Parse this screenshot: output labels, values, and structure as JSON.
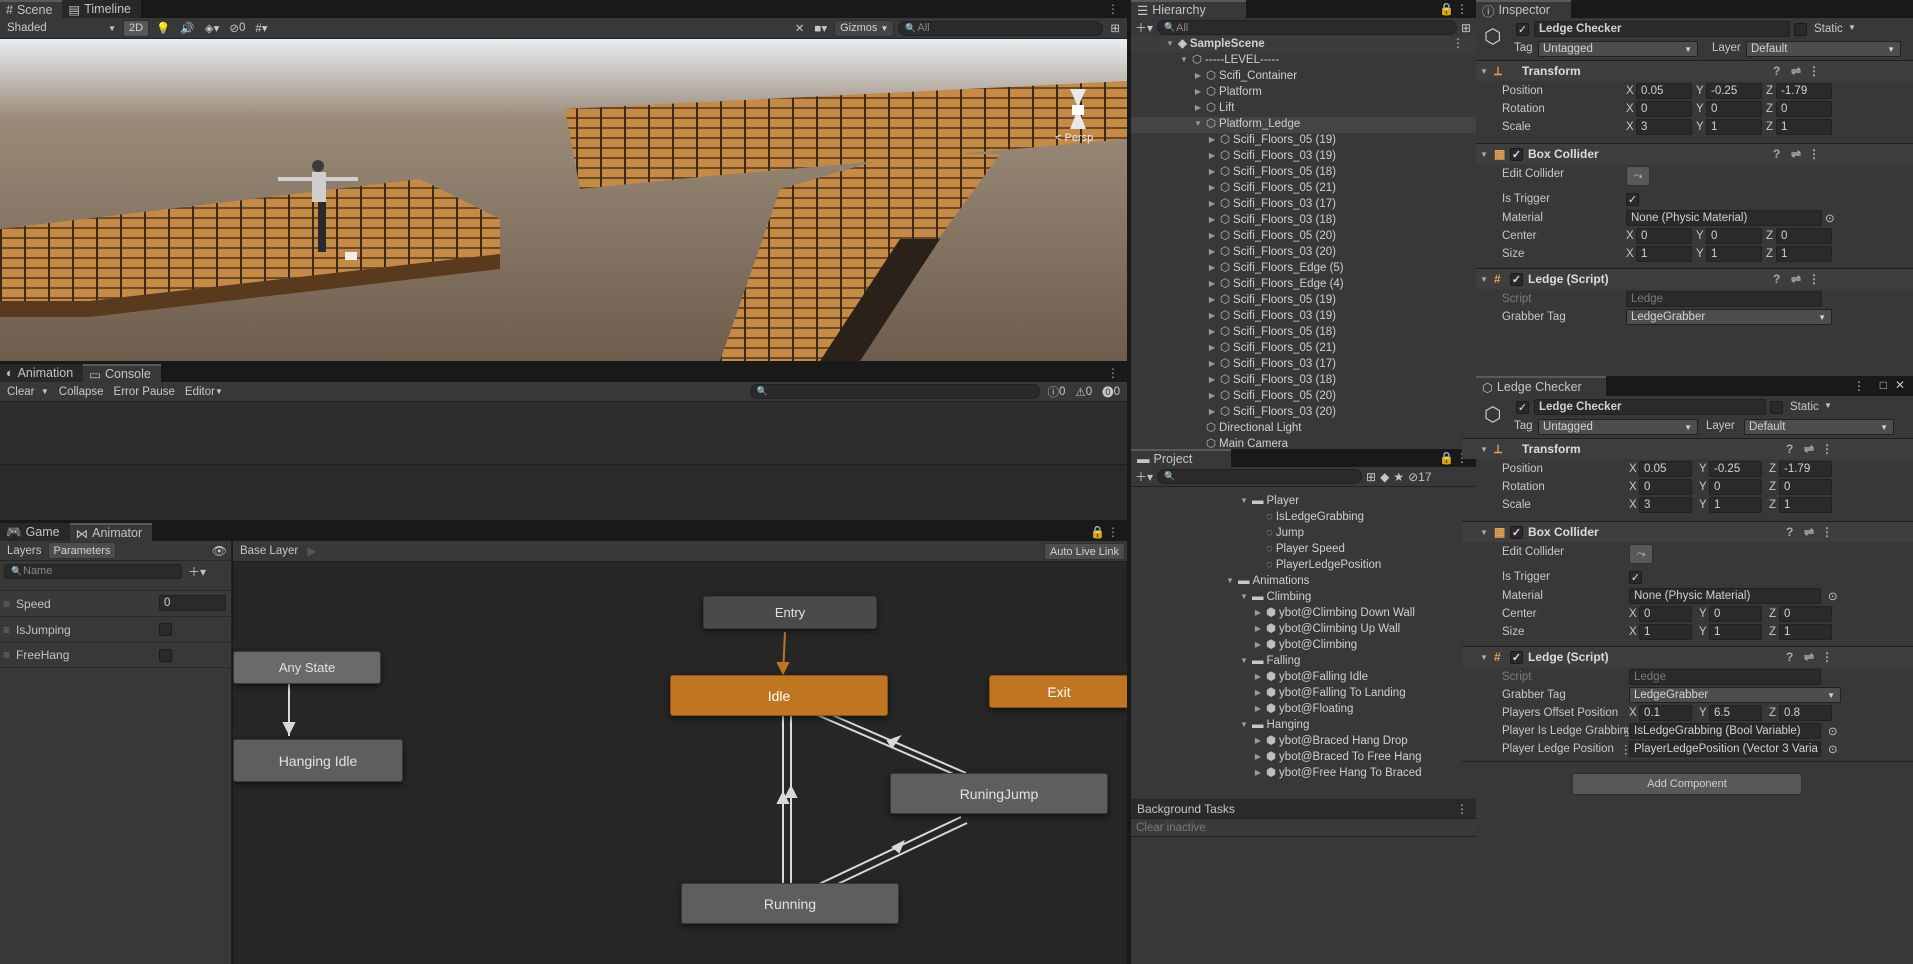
{
  "scene_tabs": [
    {
      "label": "Scene",
      "icon": "hash-icon"
    },
    {
      "label": "Timeline",
      "icon": "timeline-icon"
    }
  ],
  "scene_toolbar": {
    "shading": "Shaded",
    "mode_2d": "2D",
    "hidden_count": "0",
    "gizmos": "Gizmos",
    "search_placeholder": "All",
    "persp": "< Persp"
  },
  "console_tabs": [
    {
      "label": "Animation"
    },
    {
      "label": "Console"
    }
  ],
  "console_toolbar": {
    "clear": "Clear",
    "collapse": "Collapse",
    "error_pause": "Error Pause",
    "editor": "Editor",
    "log_count": "0",
    "warn_count": "0",
    "error_count": "0"
  },
  "game_tabs": [
    {
      "label": "Game"
    },
    {
      "label": "Animator"
    }
  ],
  "animator": {
    "layers_tab": "Layers",
    "parameters_tab": "Parameters",
    "name_placeholder": "Name",
    "base_layer": "Base Layer",
    "auto_live_link": "Auto Live Link",
    "parameters": [
      {
        "name": "Speed",
        "type": "float",
        "value": "0"
      },
      {
        "name": "IsJumping",
        "type": "bool",
        "value": false
      },
      {
        "name": "FreeHang",
        "type": "bool",
        "value": false
      }
    ],
    "states": {
      "entry": "Entry",
      "any_state": "Any State",
      "idle": "Idle",
      "exit": "Exit",
      "hanging_idle": "Hanging Idle",
      "runing_jump": "RuningJump",
      "running": "Running"
    },
    "colors": {
      "default_state": "#c07520",
      "state": "#5e5e5e",
      "entry": "#4a4a4a"
    }
  },
  "hierarchy": {
    "tab": "Hierarchy",
    "search_placeholder": "All",
    "scene_name": "SampleScene",
    "items": [
      {
        "label": "-----LEVEL-----",
        "depth": 1
      },
      {
        "label": "Scifi_Container",
        "depth": 2
      },
      {
        "label": "Platform",
        "depth": 2
      },
      {
        "label": "Lift",
        "depth": 2
      },
      {
        "label": "Platform_Ledge",
        "depth": 2
      },
      {
        "label": "Scifi_Floors_05 (19)",
        "depth": 3
      },
      {
        "label": "Scifi_Floors_03 (19)",
        "depth": 3
      },
      {
        "label": "Scifi_Floors_05 (18)",
        "depth": 3
      },
      {
        "label": "Scifi_Floors_05 (21)",
        "depth": 3
      },
      {
        "label": "Scifi_Floors_03 (17)",
        "depth": 3
      },
      {
        "label": "Scifi_Floors_03 (18)",
        "depth": 3
      },
      {
        "label": "Scifi_Floors_05 (20)",
        "depth": 3
      },
      {
        "label": "Scifi_Floors_03 (20)",
        "depth": 3
      },
      {
        "label": "Scifi_Floors_Edge (5)",
        "depth": 3
      },
      {
        "label": "Scifi_Floors_Edge (4)",
        "depth": 3
      },
      {
        "label": "Scifi_Floors_05 (19)",
        "depth": 3
      },
      {
        "label": "Scifi_Floors_03 (19)",
        "depth": 3
      },
      {
        "label": "Scifi_Floors_05 (18)",
        "depth": 3
      },
      {
        "label": "Scifi_Floors_05 (21)",
        "depth": 3
      },
      {
        "label": "Scifi_Floors_03 (17)",
        "depth": 3
      },
      {
        "label": "Scifi_Floors_03 (18)",
        "depth": 3
      },
      {
        "label": "Scifi_Floors_05 (20)",
        "depth": 3
      },
      {
        "label": "Scifi_Floors_03 (20)",
        "depth": 3
      },
      {
        "label": "Directional Light",
        "depth": 2
      },
      {
        "label": "Main Camera",
        "depth": 2
      }
    ]
  },
  "project": {
    "tab": "Project",
    "hidden_count": "17",
    "items": [
      {
        "label": "Player",
        "type": "folder",
        "depth": 0
      },
      {
        "label": "IsLedgeGrabbing",
        "type": "asset",
        "depth": 1
      },
      {
        "label": "Jump",
        "type": "asset",
        "depth": 1
      },
      {
        "label": "Player Speed",
        "type": "asset",
        "depth": 1
      },
      {
        "label": "PlayerLedgePosition",
        "type": "asset",
        "depth": 1
      },
      {
        "label": "Animations",
        "type": "folder",
        "depth": -1
      },
      {
        "label": "Climbing",
        "type": "folder",
        "depth": 0
      },
      {
        "label": "ybot@Climbing Down Wall",
        "type": "model",
        "depth": 1
      },
      {
        "label": "ybot@Climbing Up Wall",
        "type": "model",
        "depth": 1
      },
      {
        "label": "ybot@Climbing",
        "type": "model",
        "depth": 1
      },
      {
        "label": "Falling",
        "type": "folder",
        "depth": 0
      },
      {
        "label": "ybot@Falling Idle",
        "type": "model",
        "depth": 1
      },
      {
        "label": "ybot@Falling To Landing",
        "type": "model",
        "depth": 1
      },
      {
        "label": "ybot@Floating",
        "type": "model",
        "depth": 1
      },
      {
        "label": "Hanging",
        "type": "folder",
        "depth": 0
      },
      {
        "label": "ybot@Braced Hang Drop",
        "type": "model",
        "depth": 1
      },
      {
        "label": "ybot@Braced To Free Hang",
        "type": "model",
        "depth": 1
      },
      {
        "label": "ybot@Free Hang To Braced",
        "type": "model",
        "depth": 1
      }
    ]
  },
  "background_tasks": {
    "title": "Background Tasks",
    "clear_inactive": "Clear inactive"
  },
  "inspector": {
    "tab": "Inspector",
    "object_name": "Ledge Checker",
    "static_label": "Static",
    "tag_label": "Tag",
    "tag_value": "Untagged",
    "layer_label": "Layer",
    "layer_value": "Default",
    "transform": {
      "title": "Transform",
      "position_label": "Position",
      "position": [
        "0.05",
        "-0.25",
        "-1.79"
      ],
      "rotation_label": "Rotation",
      "rotation": [
        "0",
        "0",
        "0"
      ],
      "scale_label": "Scale",
      "scale": [
        "3",
        "1",
        "1"
      ]
    },
    "box_collider": {
      "title": "Box Collider",
      "edit_label": "Edit Collider",
      "trigger_label": "Is Trigger",
      "trigger": true,
      "material_label": "Material",
      "material": "None (Physic Material)",
      "center_label": "Center",
      "center": [
        "0",
        "0",
        "0"
      ],
      "size_label": "Size",
      "size": [
        "1",
        "1",
        "1"
      ]
    },
    "ledge_script": {
      "title": "Ledge (Script)",
      "script_label": "Script",
      "script": "Ledge",
      "grabber_label": "Grabber Tag",
      "grabber": "LedgeGrabber"
    }
  },
  "inspector2": {
    "tab": "Ledge Checker",
    "object_name": "Ledge Checker",
    "static_label": "Static",
    "tag_label": "Tag",
    "tag_value": "Untagged",
    "layer_label": "Layer",
    "layer_value": "Default",
    "transform": {
      "title": "Transform",
      "position_label": "Position",
      "position": [
        "0.05",
        "-0.25",
        "-1.79"
      ],
      "rotation_label": "Rotation",
      "rotation": [
        "0",
        "0",
        "0"
      ],
      "scale_label": "Scale",
      "scale": [
        "3",
        "1",
        "1"
      ]
    },
    "box_collider": {
      "title": "Box Collider",
      "edit_label": "Edit Collider",
      "trigger_label": "Is Trigger",
      "trigger": true,
      "material_label": "Material",
      "material": "None (Physic Material)",
      "center_label": "Center",
      "center": [
        "0",
        "0",
        "0"
      ],
      "size_label": "Size",
      "size": [
        "1",
        "1",
        "1"
      ]
    },
    "ledge_script": {
      "title": "Ledge (Script)",
      "script_label": "Script",
      "script": "Ledge",
      "grabber_label": "Grabber Tag",
      "grabber": "LedgeGrabber",
      "offset_label": "Players Offset Position",
      "offset": [
        "0.1",
        "6.5",
        "0.8"
      ],
      "is_grabbing_label": "Player Is Ledge Grabbing",
      "is_grabbing": "IsLedgeGrabbing (Bool Variable)",
      "ledge_pos_label": "Player Ledge Position",
      "ledge_pos": "PlayerLedgePosition (Vector 3 Varia"
    },
    "add_component": "Add Component"
  },
  "axis_labels": {
    "x": "X",
    "y": "Y",
    "z": "Z"
  }
}
